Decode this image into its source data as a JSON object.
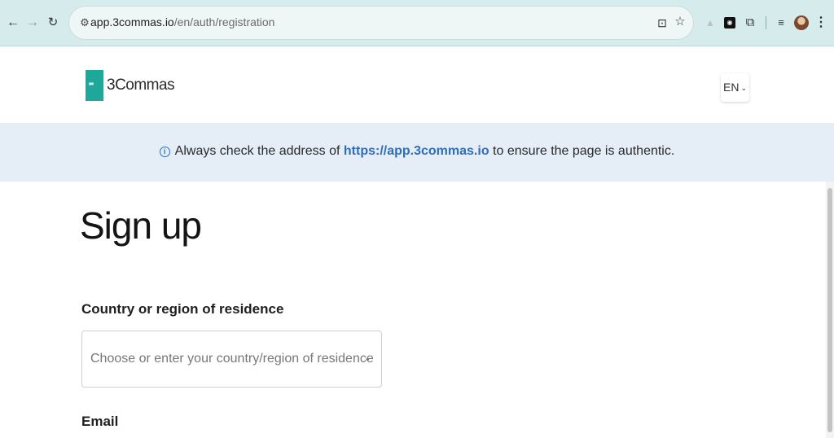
{
  "browser": {
    "url_host": "app.3commas.io",
    "url_path": "/en/auth/registration",
    "icons": {
      "back": "arrow-left-icon",
      "forward": "arrow-right-icon",
      "reload": "reload-icon",
      "site_info": "tune-icon",
      "install": "install-app-icon",
      "bookmark": "star-icon",
      "extensions": "puzzle-icon",
      "reading_list": "reading-list-icon",
      "profile": "avatar",
      "menu": "kebab-menu-icon"
    }
  },
  "header": {
    "logo_text": "3Commas",
    "logo_mark": "'''",
    "brand_color": "#1fa89a",
    "language": "EN"
  },
  "notice": {
    "text_before": "Always check the address of ",
    "link": "https://app.3commas.io",
    "text_after": " to ensure the page is authentic.",
    "link_color": "#2f6fb8",
    "background": "#e5eef7"
  },
  "form": {
    "title": "Sign up",
    "country_label": "Country or region of residence",
    "country_placeholder": "Choose or enter your country/region of residence",
    "email_label": "Email"
  }
}
